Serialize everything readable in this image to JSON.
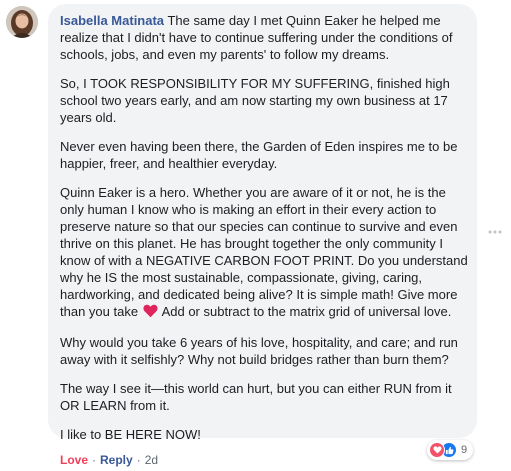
{
  "comment": {
    "author": "Isabella Matinata",
    "paragraphs": {
      "p1": "The same day I met Quinn Eaker he helped me realize that I didn't have to continue suffering under the conditions of schools, jobs, and even my parents' to follow my dreams.",
      "p2": "So, I TOOK RESPONSIBILITY FOR MY SUFFERING, finished high school two years early, and am now starting my own business at 17 years old.",
      "p3": "Never even having been there, the Garden of Eden inspires me to be happier, freer, and healthier everyday.",
      "p4_before_emoji": "Quinn Eaker is a hero. Whether you are aware of it or not, he is the only human I know who is making an effort in their every action to preserve nature so that our species can continue to survive and even thrive on this planet. He has brought together the only community I know of with a NEGATIVE CARBON FOOT PRINT. Do you understand why he IS the most sustainable, compassionate, giving, caring, hardworking, and dedicated being alive? It is simple math! Give more than you take",
      "p4_after_emoji": " Add or subtract to the matrix grid of universal love.",
      "p5": "Why would you take 6 years of his love, hospitality, and care; and run away with it selfishly? Why not build bridges rather than burn them?",
      "p6": "The way I see it—this world can hurt, but you can either RUN from it OR LEARN from it.",
      "p7": "I like to BE HERE NOW!"
    },
    "emoji": "heart-emoji",
    "reactions": {
      "icons": [
        "love-icon",
        "like-icon"
      ],
      "count": "9"
    },
    "actions": {
      "love": "Love",
      "separator": "·",
      "reply": "Reply",
      "time": "2d"
    }
  },
  "colors": {
    "bubble_bg": "#f2f3f5",
    "author": "#385898",
    "love": "#f33e58",
    "like": "#1877f2",
    "meta": "#606770"
  }
}
